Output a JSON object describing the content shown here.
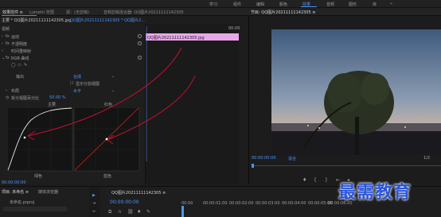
{
  "workspaces": [
    "学习",
    "组件",
    "编辑",
    "颜色",
    "效果",
    "音频",
    "图形",
    "库"
  ],
  "active_workspace": "效果",
  "panel_tabs": {
    "effect_controls": "效果控件 ≡",
    "lumetri_scopes": "Lumetri 范围",
    "source": "源：(无剪辑)",
    "audio_mixer": "音频剪辑混合器: QQ图片20211111142305",
    "program": "节目: QQ图片20211111142305 ≡"
  },
  "effect_controls": {
    "clip_label": "主要 * QQ图片20211111142305.jpg",
    "sequence_label": "QQ图片20211111142305 * QQ图片2...",
    "section_video": "视频",
    "effects": [
      "运动",
      "不透明度",
      "时间重映射"
    ],
    "curves_effect": "RGB 曲线",
    "output_label": "输出",
    "output_value": "合成",
    "show_split_view": "显示分割视图",
    "layout_label": "布局",
    "layout_value": "水平",
    "split_percent_label": "拆分视图百分比",
    "split_percent_value": "50.00 %",
    "curve_headers": [
      "主要",
      "红色"
    ],
    "curve_footers": [
      "绿色",
      "蓝色"
    ],
    "timecode": "00:00:00:00"
  },
  "mini_timeline": {
    "clip_name": "QQ图片20211111142305.jpg",
    "timecode": "00:00"
  },
  "program_monitor": {
    "timecode": "00:00:00:00",
    "fit": "适合",
    "quality": "1/2"
  },
  "project_panel": {
    "tabs": [
      "项目: 未命名 ≡",
      "媒体浏览器"
    ],
    "name": "未命名.prproj"
  },
  "timeline": {
    "title": "QQ图片20211111142305 ≡",
    "timecode": "00:00:00:00",
    "ruler": [
      "00:00",
      "00:00:01:00",
      "00:00:02:00",
      "00:00:03:00",
      "00:00:04:00",
      "00:00:05:00",
      "00:00:06:00"
    ]
  },
  "watermark": "最需教育",
  "colors": {
    "accent": "#4a95ff",
    "clip": "#e8a8e8",
    "annotation": "#c8102e",
    "watermark": "#2a55d8"
  }
}
